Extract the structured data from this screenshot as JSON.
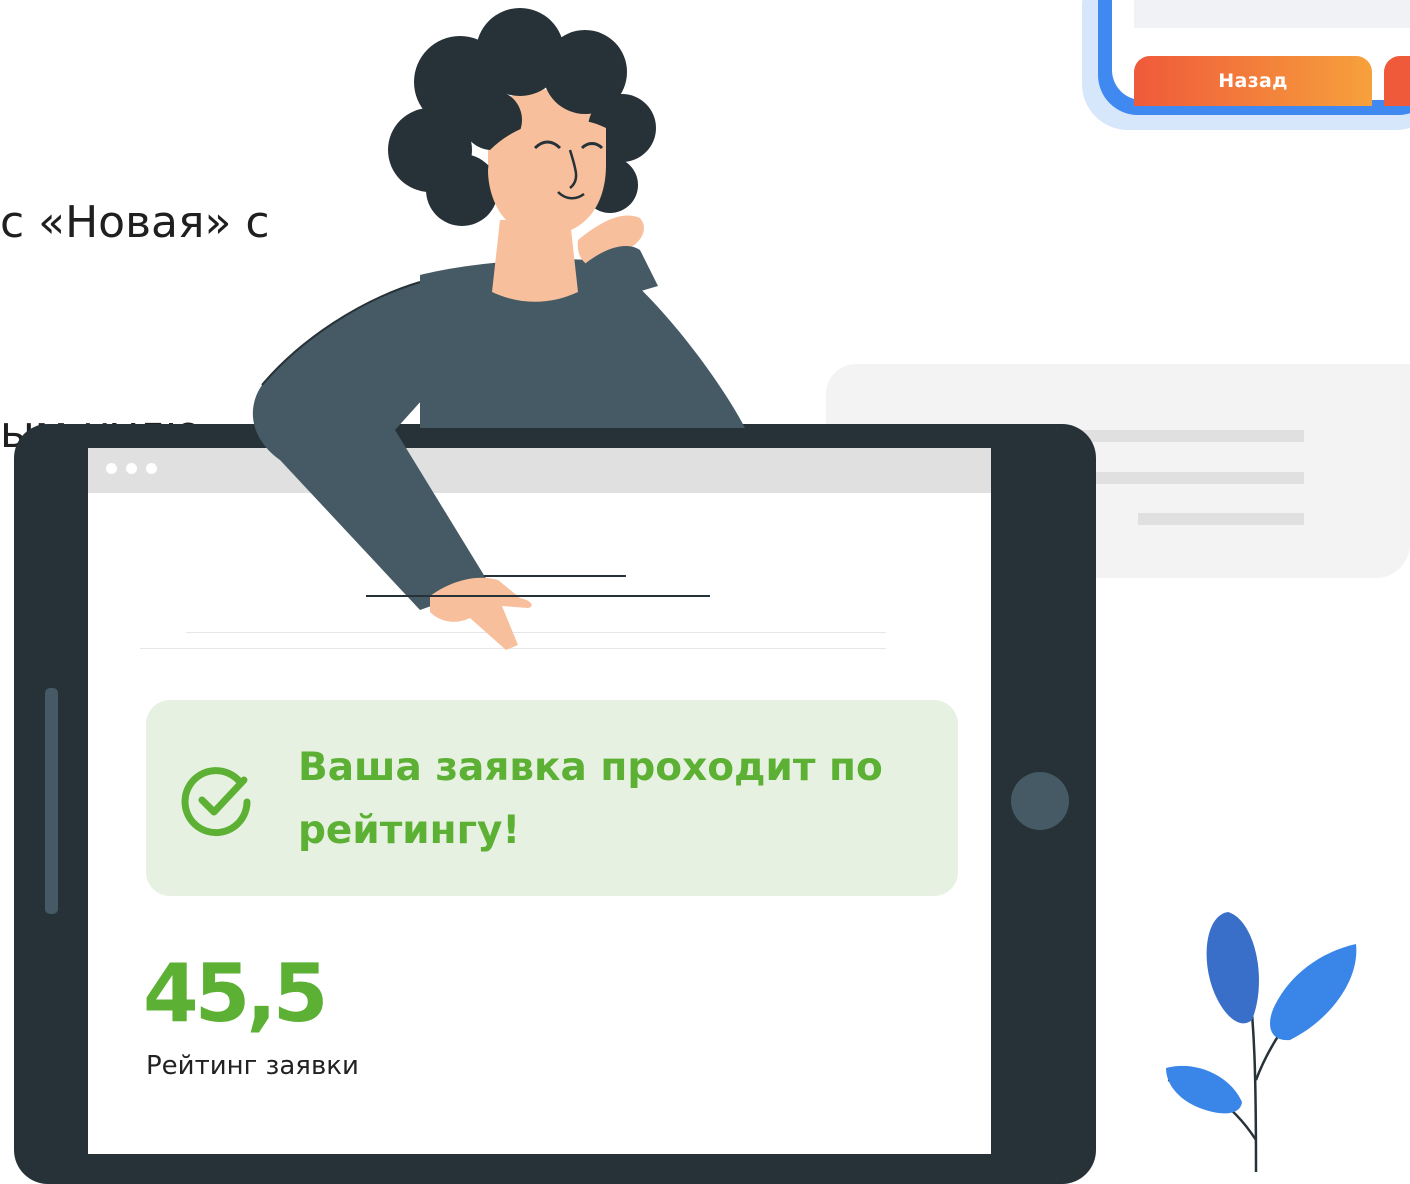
{
  "heading": {
    "line1": "с «Новая» с",
    "line2": "ым нулю."
  },
  "mini_phone": {
    "back_button_label": "Назад"
  },
  "notice": {
    "text": "Ваша заявка проходит по рейтингу!",
    "icon": "check-circle-icon"
  },
  "rating": {
    "value": "45,5",
    "label": "Рейтинг заявки"
  },
  "colors": {
    "accent_green": "#5cb034",
    "notice_background": "#e7f1e1",
    "tablet_body": "#263238",
    "shirt": "#455a64",
    "back_button_gradient_start": "#ef5a3a",
    "back_button_gradient_end": "#f6a13c",
    "phone_frame_blue": "#3f89f0",
    "plant_blue": "#3a86e8"
  },
  "illustration": {
    "person_icon": "person-illustration",
    "plant_icon": "plant-icon",
    "chat_icon": "chat-bubble-icon"
  }
}
